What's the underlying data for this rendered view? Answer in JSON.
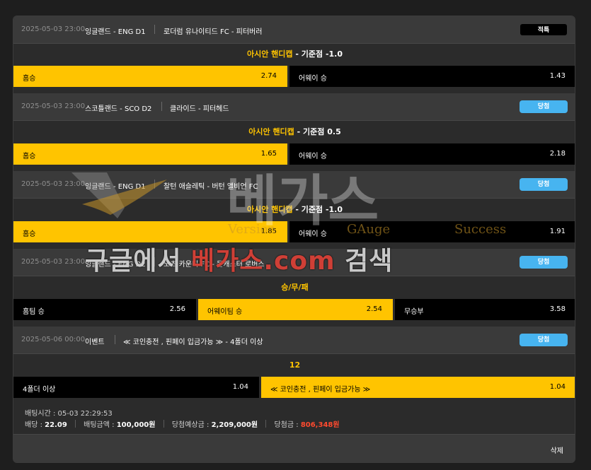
{
  "bets": [
    {
      "date": "2025-05-03 23:00",
      "league": "잉글랜드 - ENG D1",
      "match": "로더럼 유나이티드 FC - 피터버러",
      "status": "적특",
      "market": "아시안 핸디캡",
      "line": "- 기준점 -1.0",
      "options": [
        {
          "label": "홈승",
          "odds": "2.74",
          "selected": true
        },
        {
          "label": "어웨이 승",
          "odds": "1.43",
          "selected": false
        }
      ]
    },
    {
      "date": "2025-05-03 23:00",
      "league": "스코틀랜드 - SCO D2",
      "match": "클라이드 - 피터헤드",
      "status": "당첨",
      "market": "아시안 핸디캡",
      "line": "- 기준점 0.5",
      "options": [
        {
          "label": "홈승",
          "odds": "1.65",
          "selected": true
        },
        {
          "label": "어웨이 승",
          "odds": "2.18",
          "selected": false
        }
      ]
    },
    {
      "date": "2025-05-03 23:00",
      "league": "잉글랜드 - ENG D1",
      "match": "찰턴 애슬레틱 - 버턴 앨비언 FC",
      "status": "당첨",
      "market": "아시안 핸디캡",
      "line": "- 기준점 -1.0",
      "options": [
        {
          "label": "홈승",
          "odds": "1.85",
          "selected": true
        },
        {
          "label": "어웨이 승",
          "odds": "1.91",
          "selected": false
        }
      ]
    },
    {
      "date": "2025-05-03 23:00",
      "league": "잉글랜드 - ENG D2",
      "match": "노츠 카운티 FC - 돈캐스터 로버스",
      "status": "당첨",
      "market": "승/무/패",
      "line": "",
      "options": [
        {
          "label": "홈팀 승",
          "odds": "2.56",
          "selected": false
        },
        {
          "label": "어웨이팀 승",
          "odds": "2.54",
          "selected": true
        },
        {
          "label": "무승부",
          "odds": "3.58",
          "selected": false
        }
      ]
    },
    {
      "date": "2025-05-06 00:00",
      "league": "이벤트",
      "match": "≪ 코인충전 , 핀페이 입금가능 ≫ - 4폴더 이상",
      "status": "당첨",
      "market": "12",
      "line": "",
      "options": [
        {
          "label": "4폴더 이상",
          "odds": "1.04",
          "selected": false
        },
        {
          "label": "≪ 코인충전 , 핀페이 입금가능 ≫",
          "odds": "1.04",
          "selected": true
        }
      ]
    }
  ],
  "summary": {
    "bet_time_label": "배팅시간 :",
    "bet_time": "05-03 22:29:53",
    "odds_label": "배당 :",
    "odds": "22.09",
    "amount_label": "배팅금액 :",
    "amount": "100,000원",
    "expected_label": "당첨예상금 :",
    "expected": "2,209,000원",
    "payout_label": "당첨금 :",
    "payout": "806,348원"
  },
  "delete_label": "삭제",
  "watermark": {
    "brand": "베가스",
    "tag1": "Version",
    "tag2": "GAuge",
    "tag3": "Success",
    "line_a": "구글에서 ",
    "line_b": "베가스.com",
    "line_c": " 검색"
  },
  "colors": {
    "accent": "#ffc400",
    "win_badge": "#47b4f0",
    "lose_badge": "#000000",
    "payout": "#ff4a2e"
  }
}
